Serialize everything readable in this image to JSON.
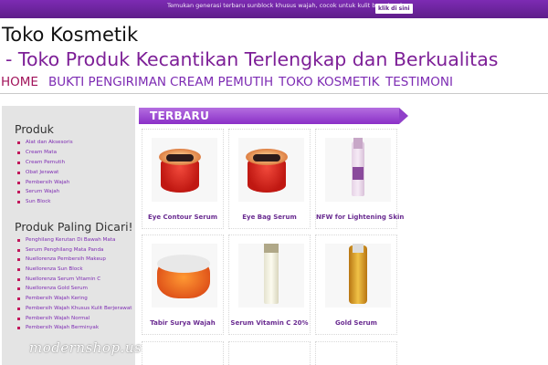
{
  "topbar": {
    "promo_text": "Temukan generasi terbaru sunblock khusus wajah, cocok untuk kulit berminyak",
    "button_label": "klik di sini"
  },
  "header": {
    "title": "Toko Kosmetik",
    "tagline": " - Toko Produk Kecantikan Terlengkap dan Berkualitas"
  },
  "nav": {
    "items": [
      {
        "label": "HOME",
        "active": true
      },
      {
        "label": "BUKTI PENGIRIMAN"
      },
      {
        "label": "CREAM PEMUTIH"
      },
      {
        "label": "TOKO KOSMETIK"
      },
      {
        "label": "TESTIMONI"
      }
    ]
  },
  "sidebar": {
    "products_heading": "Produk",
    "products": [
      "Alat dan Aksesoris",
      "Cream Mata",
      "Cream Pemutih",
      "Obat Jerawat",
      "Pembersih Wajah",
      "Serum Wajah",
      "Sun Block"
    ],
    "popular_heading": "Produk Paling Dicari!",
    "popular": [
      "Penghilang Kerutan Di Bawah Mata",
      "Serum Penghilang Mata Panda",
      "Nuellorenza Pembersih Makeup",
      "Nuellorenza Sun Block",
      "Nuellorenza Serum Vitamin C",
      "Nuellorenza Gold Serum",
      "Pembersih Wajah Kering",
      "Pembersih Wajah Khusus Kulit Berjerawat",
      "Pembersih Wajah Normal",
      "Pembersih Wajah Berminyak"
    ],
    "logo_text": "modernshop.us"
  },
  "main": {
    "section_title": "TERBARU",
    "products": [
      {
        "name": "Eye Contour Serum"
      },
      {
        "name": "Eye Bag Serum"
      },
      {
        "name": "NFW for Lightening Skin"
      },
      {
        "name": "Tabir Surya Wajah"
      },
      {
        "name": "Serum Vitamin C 20%"
      },
      {
        "name": "Gold Serum"
      }
    ]
  },
  "colors": {
    "accent": "#7d2bb3",
    "active_nav": "#a1135a",
    "tagline": "#7d1f97",
    "sidebar_bg": "#e4e4e4"
  }
}
